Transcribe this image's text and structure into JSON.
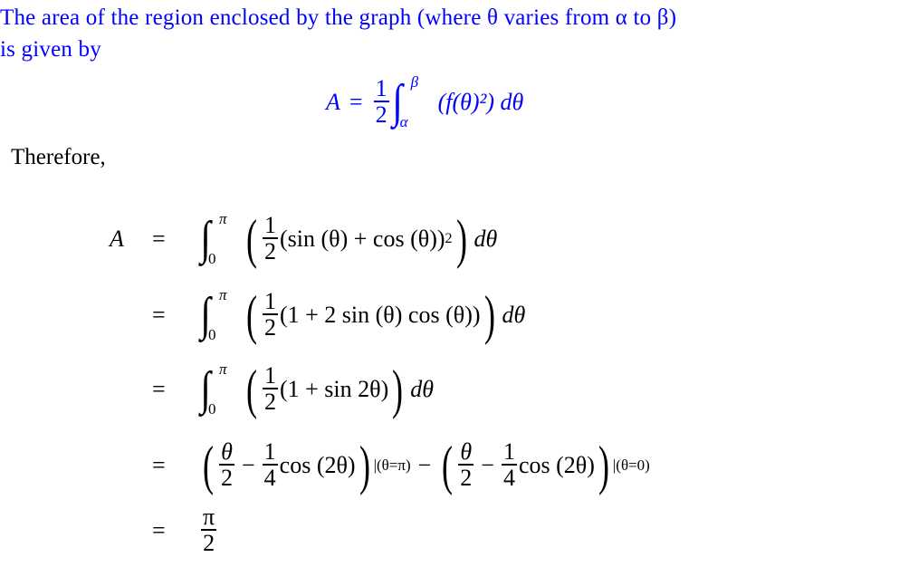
{
  "intro": {
    "line1": "The area of the region enclosed by the graph (where θ varies from α to β)",
    "line2": "is given by",
    "color": "#0000ff"
  },
  "formula": {
    "lhs": "A",
    "eq": "=",
    "frac_num": "1",
    "frac_den": "2",
    "upper": "β",
    "lower": "α",
    "integrand": "(f(θ)²) dθ"
  },
  "therefore": "Therefore,",
  "derivation": [
    {
      "lhs": "A",
      "eq": "=",
      "upper": "π",
      "lower": "0",
      "num": "1",
      "den": "2",
      "body": "(sin (θ) + cos (θ))",
      "power": "2",
      "tail": "dθ"
    },
    {
      "lhs": "",
      "eq": "=",
      "upper": "π",
      "lower": "0",
      "num": "1",
      "den": "2",
      "body": "(1 + 2 sin (θ) cos (θ))",
      "tail": "dθ"
    },
    {
      "lhs": "",
      "eq": "=",
      "upper": "π",
      "lower": "0",
      "num": "1",
      "den": "2",
      "body": "(1 + sin 2θ)",
      "tail": "dθ"
    },
    {
      "lhs": "",
      "eq": "=",
      "t1_num": "θ",
      "t1_den": "2",
      "minus": "−",
      "t2_num": "1",
      "t2_den": "4",
      "cos": "cos (2θ)",
      "eval1": "|(θ=π)",
      "eval2": "|(θ=0)"
    },
    {
      "lhs": "",
      "eq": "=",
      "result_num": "π",
      "result_den": "2"
    }
  ]
}
